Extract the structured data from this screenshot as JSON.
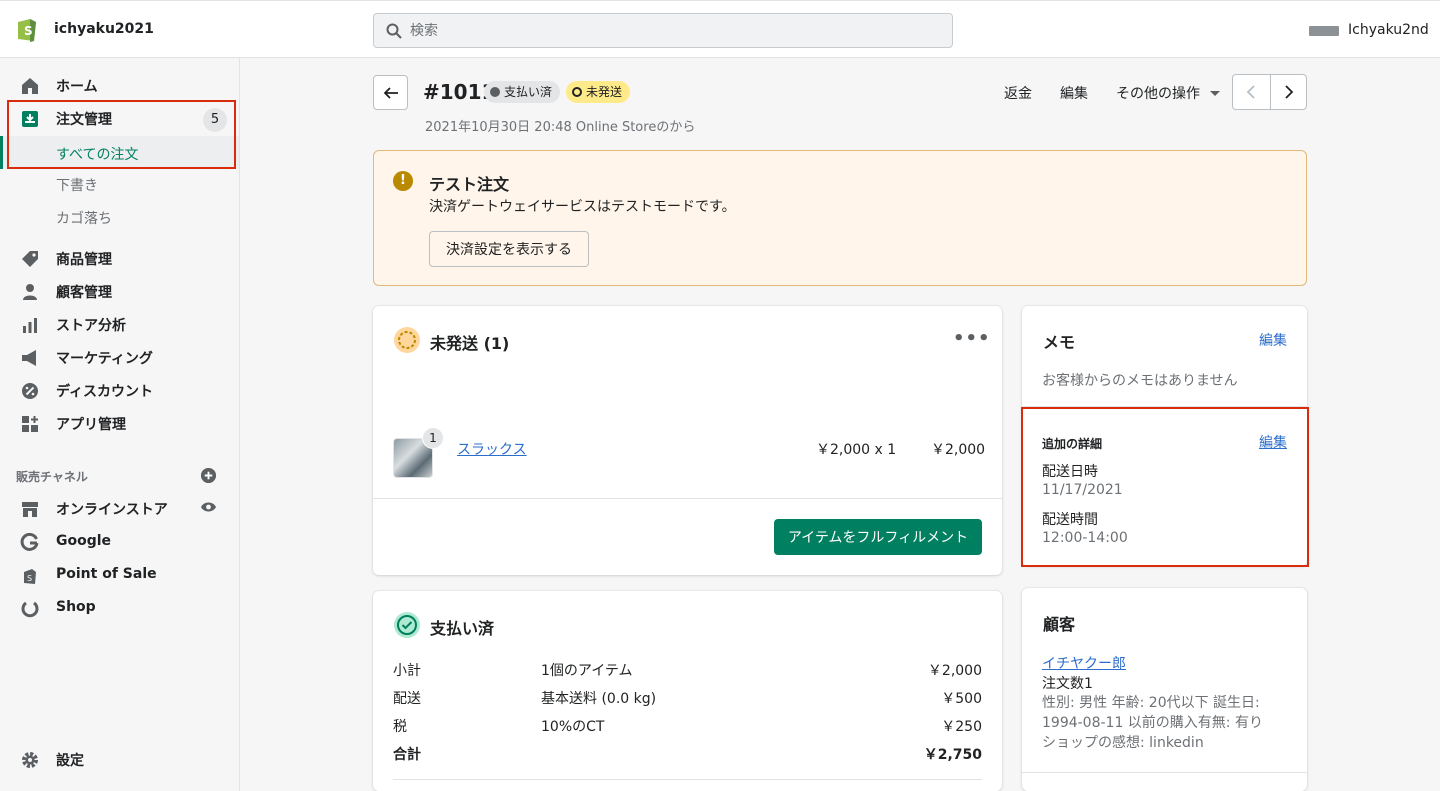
{
  "topbar": {
    "store_name": "ichyaku2021",
    "search_placeholder": "検索",
    "user_name": "Ichyaku2nd"
  },
  "sidebar": {
    "items": [
      {
        "label": "ホーム"
      },
      {
        "label": "注文管理",
        "count": "5"
      },
      {
        "label": "商品管理"
      },
      {
        "label": "顧客管理"
      },
      {
        "label": "ストア分析"
      },
      {
        "label": "マーケティング"
      },
      {
        "label": "ディスカウント"
      },
      {
        "label": "アプリ管理"
      }
    ],
    "order_subitems": [
      "すべての注文",
      "下書き",
      "カゴ落ち"
    ],
    "channels_title": "販売チャネル",
    "channels": [
      "オンラインストア",
      "Google",
      "Point of Sale",
      "Shop"
    ],
    "settings_label": "設定"
  },
  "header": {
    "order_number": "#1011",
    "badge_paid": "支払い済",
    "badge_unfulfilled": "未発送",
    "date": "2021年10月30日 20:48 Online Storeのから",
    "refund": "返金",
    "edit": "編集",
    "more_actions": "その他の操作"
  },
  "banner": {
    "title": "テスト注文",
    "text": "決済ゲートウェイサービスはテストモードです。",
    "button": "決済設定を表示する"
  },
  "unfulfilled": {
    "title": "未発送 (1)",
    "item_name": "スラックス",
    "quantity": "1",
    "unit": "￥2,000 x 1",
    "total": "￥2,000",
    "button": "アイテムをフルフィルメント"
  },
  "paid": {
    "title": "支払い済",
    "rows": [
      {
        "label": "小計",
        "desc": "1個のアイテム",
        "amount": "￥2,000"
      },
      {
        "label": "配送",
        "desc": "基本送料 (0.0 kg)",
        "amount": "￥500"
      },
      {
        "label": "税",
        "desc": "10%のCT",
        "amount": "￥250"
      },
      {
        "label": "合計",
        "desc": "",
        "amount": "￥2,750"
      }
    ]
  },
  "memo": {
    "title": "メモ",
    "edit": "編集",
    "empty": "お客様からのメモはありません",
    "details_title": "追加の詳細",
    "details_edit": "編集",
    "details": [
      {
        "key": "配送日時",
        "value": "11/17/2021"
      },
      {
        "key": "配送時間",
        "value": "12:00-14:00"
      }
    ]
  },
  "customer": {
    "title": "顧客",
    "name": "イチヤクー郎",
    "orders": "注文数1",
    "info": "性別: 男性 年齢: 20代以下 誕生日: 1994-08-11 以前の購入有無: 有り ショップの感想: linkedin"
  },
  "colors": {
    "accent": "#008060",
    "link": "#2c6ecb",
    "highlight": "#d82c0d",
    "warning_bg": "#fff5ea",
    "badge_yellow": "#ffea8a"
  },
  "icons": [
    "shopify-logo-icon",
    "search-icon",
    "home-icon",
    "orders-icon",
    "tag-icon",
    "person-icon",
    "analytics-icon",
    "megaphone-icon",
    "discount-icon",
    "apps-icon",
    "add-circle-icon",
    "store-icon",
    "eye-icon",
    "google-icon",
    "pos-icon",
    "shop-icon",
    "gear-icon",
    "arrow-left-icon",
    "caret-down-icon",
    "chevron-left-icon",
    "chevron-right-icon",
    "warning-icon",
    "unfulfilled-icon",
    "checkmark-circle-icon",
    "more-horizontal-icon"
  ]
}
